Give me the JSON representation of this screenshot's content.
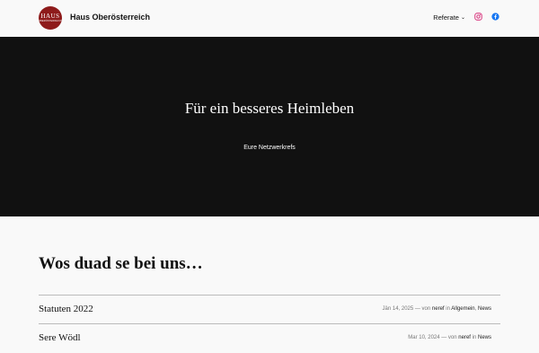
{
  "header": {
    "logo": {
      "line1": "HAUS",
      "line2": "OBERÖSTERREICH"
    },
    "site_title": "Haus Oberösterreich",
    "nav": {
      "referate_label": "Referate"
    }
  },
  "hero": {
    "title": "Für ein besseres Heimleben",
    "subtitle": "Eure Netzwerkrefs"
  },
  "posts": {
    "heading": "Wos duad se bei uns…",
    "items": [
      {
        "title": "Statuten 2022",
        "date": "Jän 14, 2025",
        "by": "— von",
        "author": "neref",
        "in": "in",
        "categories": [
          "Allgemein",
          "News"
        ]
      },
      {
        "title": "Sere Wödl",
        "date": "Mar 10, 2024",
        "by": "— von",
        "author": "neref",
        "in": "in",
        "categories": [
          "News"
        ]
      }
    ]
  },
  "colors": {
    "logo_bg": "#8e1b1b",
    "hero_bg": "#111111",
    "page_bg": "#f9f9f9",
    "instagram": "#d62976",
    "facebook": "#1877f2"
  },
  "icons": [
    "instagram-icon",
    "facebook-icon",
    "chevron-down-icon"
  ]
}
